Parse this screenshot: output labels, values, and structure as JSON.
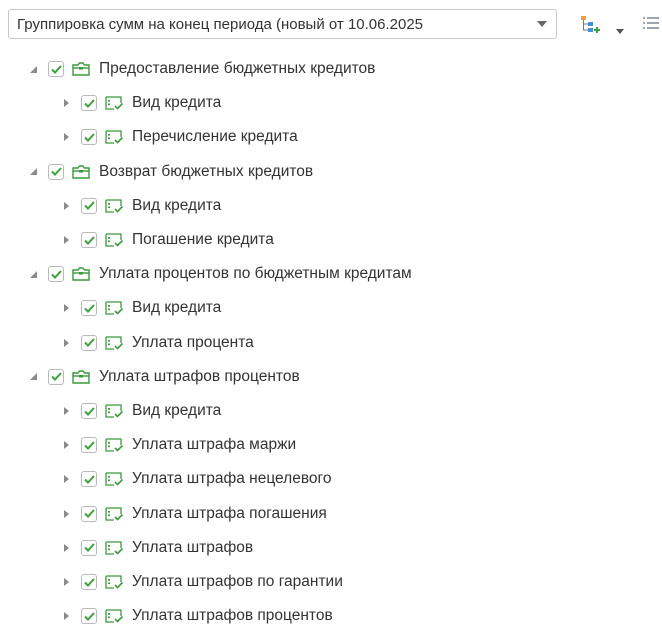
{
  "toolbar": {
    "grouping_select_value": "Группировка сумм на конец периода (новый от 10.06.2025",
    "icons": [
      "chevron-down-icon",
      "tree-structure-icon",
      "dropdown-caret-icon",
      "list-icon"
    ]
  },
  "colors": {
    "check": "#3aa33a",
    "folder": "#3a9a3a",
    "item": "#3a9a3a"
  },
  "tree": {
    "groups": [
      {
        "label": "Предоставление бюджетных кредитов",
        "expanded": true,
        "checked": true,
        "children": [
          {
            "label": "Вид кредита",
            "checked": true
          },
          {
            "label": "Перечисление кредита",
            "checked": true
          }
        ]
      },
      {
        "label": "Возврат бюджетных кредитов",
        "expanded": true,
        "checked": true,
        "children": [
          {
            "label": "Вид кредита",
            "checked": true
          },
          {
            "label": "Погашение кредита",
            "checked": true
          }
        ]
      },
      {
        "label": "Уплата процентов по бюджетным кредитам",
        "expanded": true,
        "checked": true,
        "children": [
          {
            "label": "Вид кредита",
            "checked": true
          },
          {
            "label": "Уплата процента",
            "checked": true
          }
        ]
      },
      {
        "label": "Уплата штрафов процентов",
        "expanded": true,
        "checked": true,
        "children": [
          {
            "label": "Вид кредита",
            "checked": true
          },
          {
            "label": "Уплата штрафа маржи",
            "checked": true
          },
          {
            "label": "Уплата штрафа нецелевого",
            "checked": true
          },
          {
            "label": "Уплата штрафа погашения",
            "checked": true
          },
          {
            "label": "Уплата штрафов",
            "checked": true
          },
          {
            "label": "Уплата штрафов по гарантии",
            "checked": true
          },
          {
            "label": "Уплата штрафов процентов",
            "checked": true
          }
        ]
      }
    ]
  }
}
